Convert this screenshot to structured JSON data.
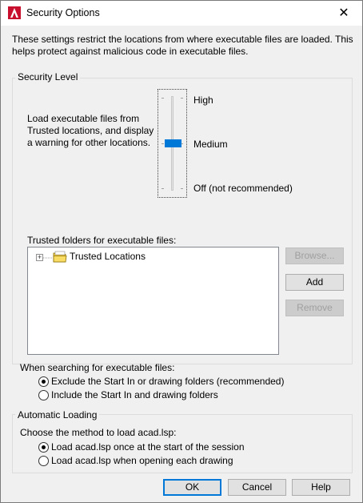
{
  "window": {
    "title": "Security Options"
  },
  "intro_text": "These settings restrict the locations from where executable files are loaded.  This helps protect against malicious code in executable files.",
  "security_level": {
    "group_label": "Security Level",
    "description": "Load executable files from Trusted locations, and display a warning for other locations.",
    "levels": [
      "High",
      "Medium",
      "Off (not recommended)"
    ],
    "selected_level": "Medium"
  },
  "trusted_folders": {
    "label": "Trusted folders for executable files:",
    "tree_root": "Trusted Locations",
    "buttons": {
      "browse": "Browse...",
      "add": "Add",
      "remove": "Remove"
    }
  },
  "search": {
    "label": "When searching for executable files:",
    "options": [
      "Exclude the Start In or drawing folders (recommended)",
      "Include the Start In and drawing folders"
    ],
    "selected_index": 0
  },
  "auto_loading": {
    "group_label": "Automatic Loading",
    "prompt": "Choose the method to load acad.lsp:",
    "options": [
      "Load acad.lsp once at the start of the session",
      "Load acad.lsp when opening each drawing"
    ],
    "selected_index": 0
  },
  "footer": {
    "ok": "OK",
    "cancel": "Cancel",
    "help": "Help"
  },
  "colors": {
    "accent": "#0078d7",
    "app_icon": "#c8102e"
  },
  "icons": {
    "app": "autocad-a-icon",
    "close": "close-icon",
    "folder": "folder-icon",
    "expander": "plus-box-icon"
  }
}
